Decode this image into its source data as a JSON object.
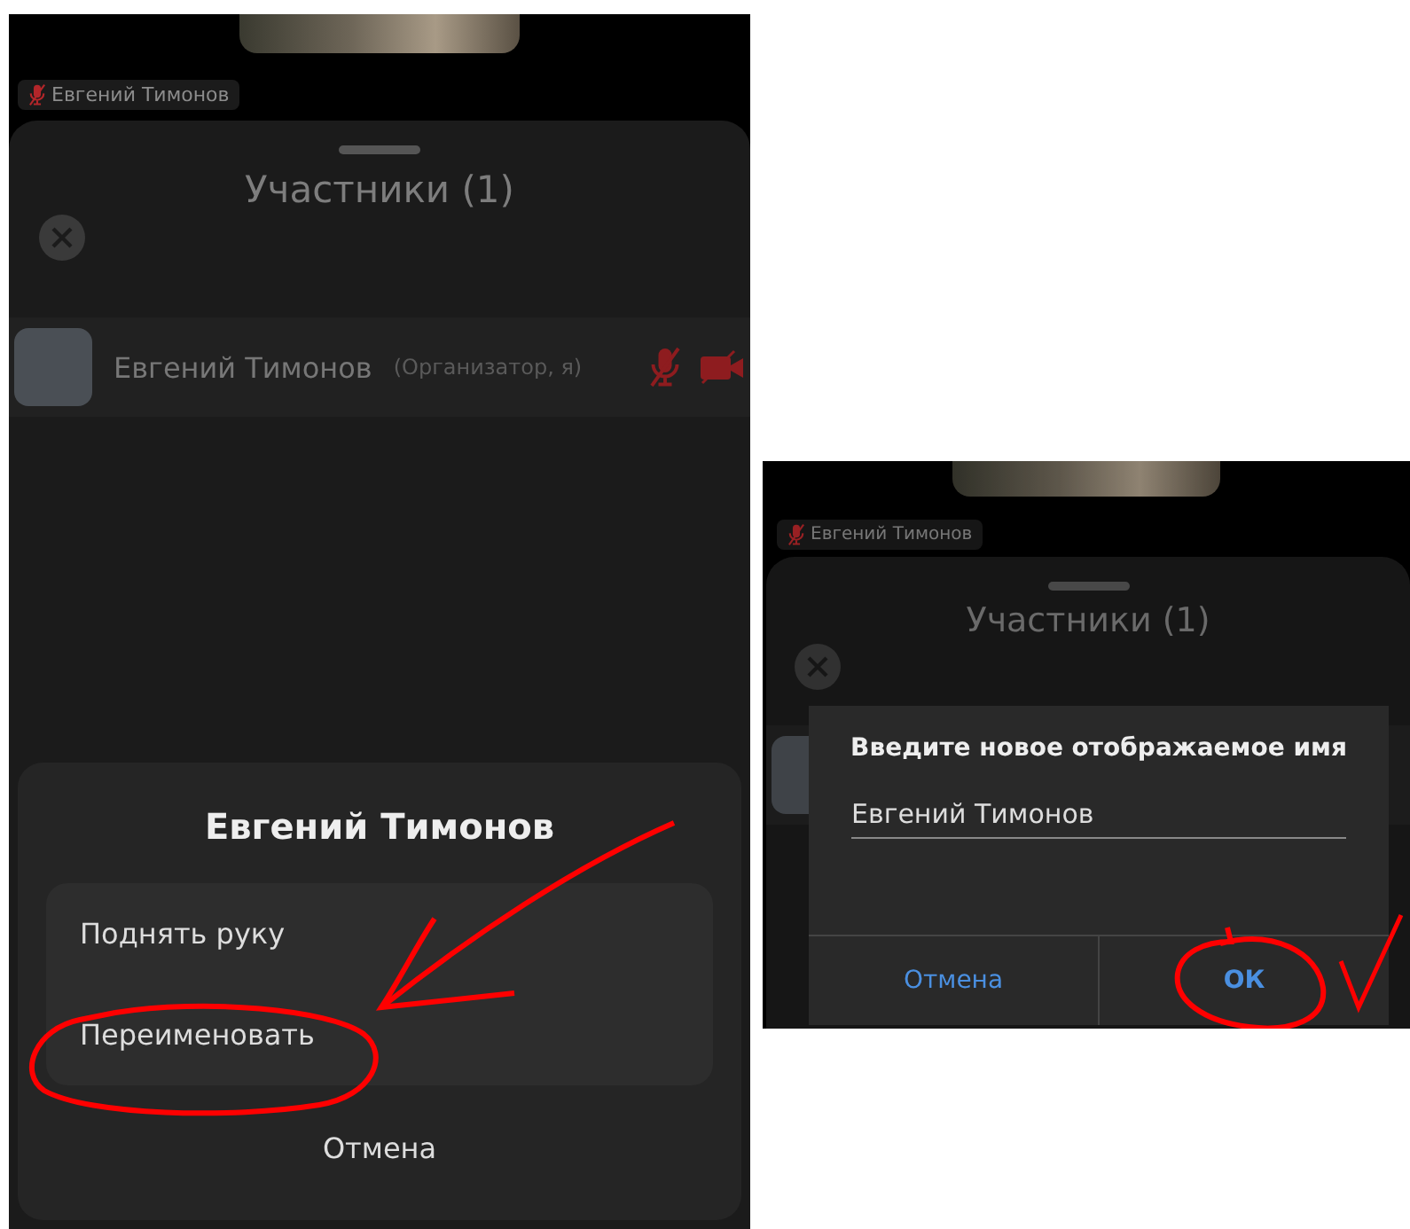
{
  "left_screen": {
    "name_tag": {
      "label": "Евгений Тимонов"
    },
    "participants_panel": {
      "title": "Участники (1)",
      "participants": [
        {
          "name": "Евгений Тимонов",
          "role": "(Организатор, я)"
        }
      ]
    },
    "action_sheet": {
      "title": "Евгений Тимонов",
      "options": [
        "Поднять руку",
        "Переименовать"
      ],
      "cancel": "Отмена"
    }
  },
  "right_screen": {
    "name_tag": {
      "label": "Евгений Тимонов"
    },
    "participants_panel": {
      "title": "Участники (1)"
    },
    "rename_dialog": {
      "title": "Введите новое отображаемое имя",
      "value": "Евгений Тимонов",
      "buttons": [
        "Отмена",
        "ОК"
      ]
    }
  }
}
